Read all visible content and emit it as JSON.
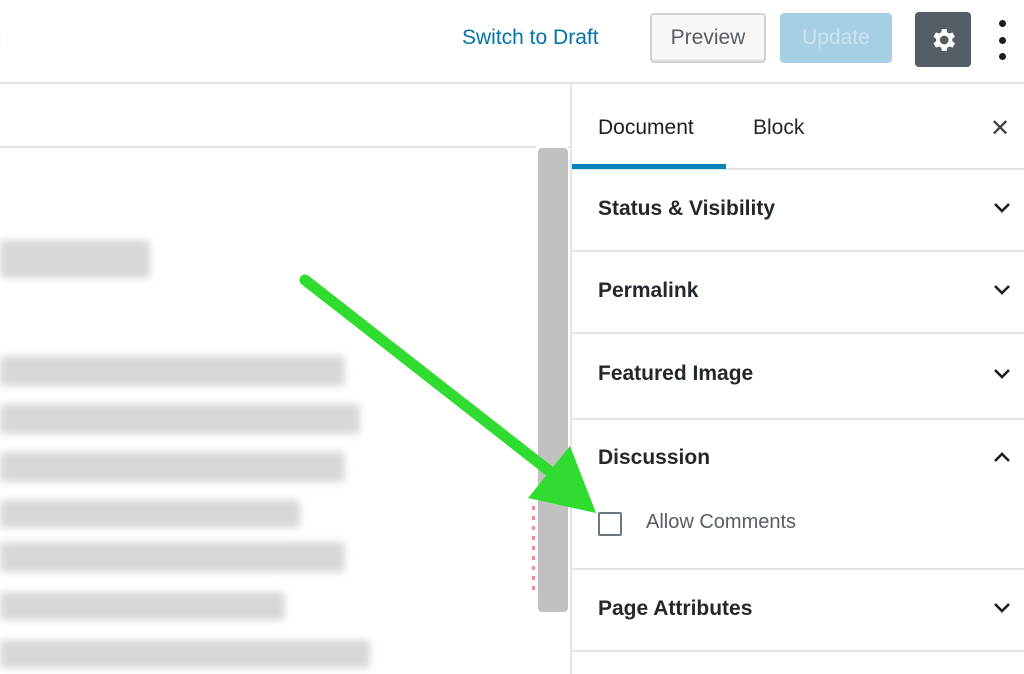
{
  "toolbar": {
    "switch_to_draft": "Switch to Draft",
    "preview": "Preview",
    "update": "Update",
    "settings_icon": "gear-icon",
    "more_icon": "vertical-ellipsis-icon"
  },
  "sidebar": {
    "tabs": [
      {
        "label": "Document"
      },
      {
        "label": "Block"
      }
    ],
    "close_icon": "close-icon",
    "panels": [
      {
        "title": "Status & Visibility"
      },
      {
        "title": "Permalink"
      },
      {
        "title": "Featured Image"
      },
      {
        "title": "Discussion"
      },
      {
        "title": "Page Attributes"
      }
    ],
    "discussion": {
      "checkbox_label": "Allow Comments",
      "checked": false
    }
  },
  "colors": {
    "accent": "#0073aa",
    "tab_underline": "#0085ba",
    "annotation_arrow": "#2fdc2f",
    "update_disabled": "#a6cfe4",
    "gear_bg": "#555d66"
  }
}
